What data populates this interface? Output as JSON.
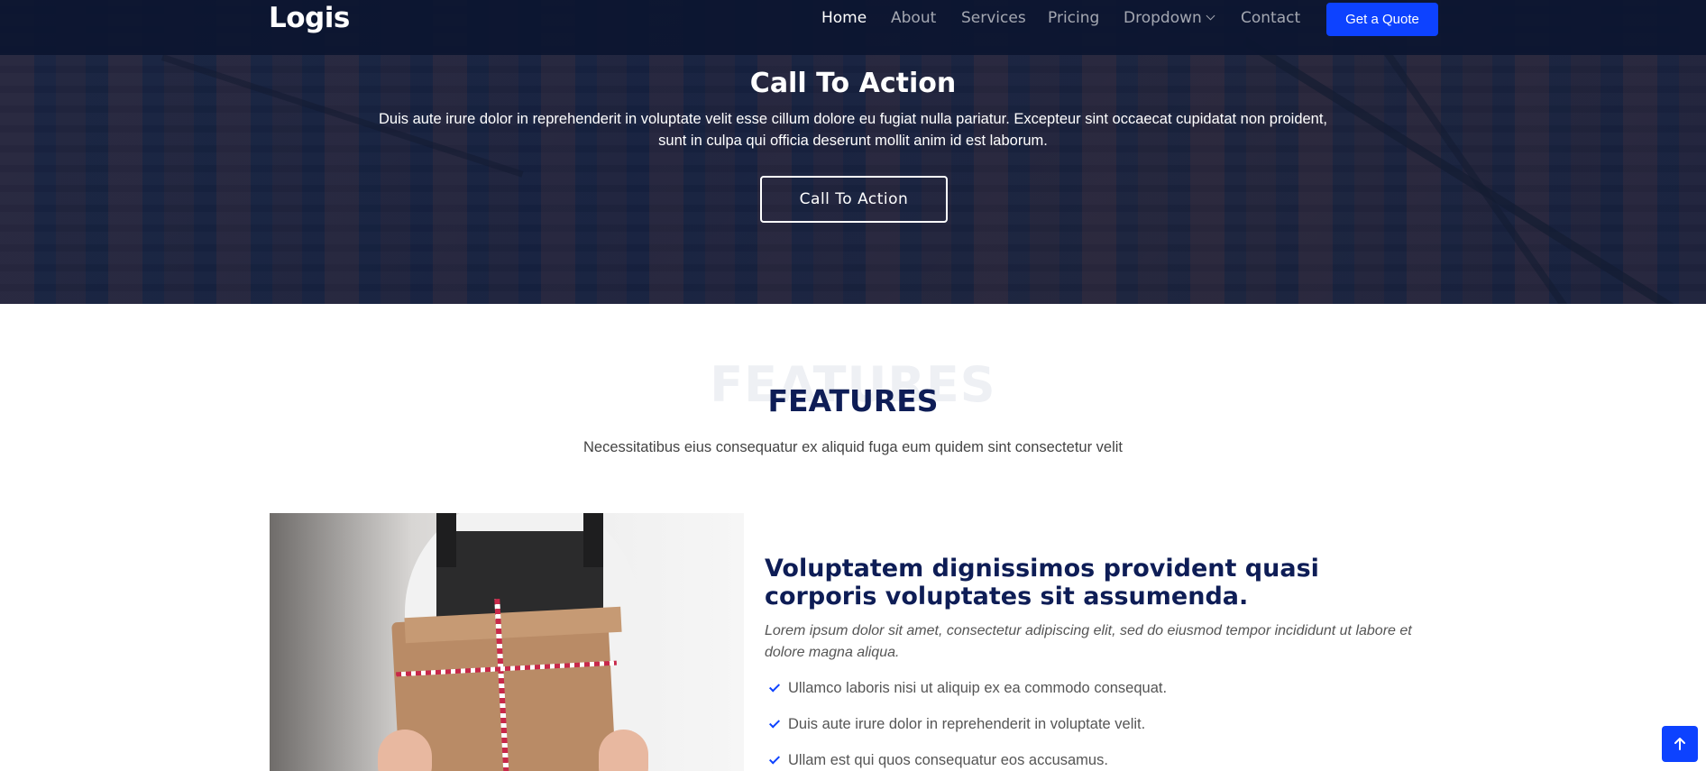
{
  "header": {
    "logo": "Logis",
    "nav": [
      {
        "label": "Home",
        "active": true
      },
      {
        "label": "About"
      },
      {
        "label": "Services"
      },
      {
        "label": "Pricing"
      },
      {
        "label": "Dropdown",
        "has_caret": true
      },
      {
        "label": "Contact"
      }
    ],
    "cta_label": "Get a Quote"
  },
  "hero": {
    "title": "Call To Action",
    "text": "Duis aute irure dolor in reprehenderit in voluptate velit esse cillum dolore eu fugiat nulla pariatur. Excepteur sint occaecat cupidatat non proident, sunt in culpa qui officia deserunt mollit anim id est laborum.",
    "button_label": "Call To Action"
  },
  "features": {
    "ghost_title": "FEATURES",
    "title": "FEATURES",
    "subtitle": "Necessitatibus eius consequatur ex aliquid fuga eum quidem sint consectetur velit",
    "heading": "Voluptatem dignissimos provident quasi corporis voluptates sit assumenda.",
    "lead": "Lorem ipsum dolor sit amet, consectetur adipiscing elit, sed do eiusmod tempor incididunt ut labore et dolore magna aliqua.",
    "items": [
      "Ullamco laboris nisi ut aliquip ex ea commodo consequat.",
      "Duis aute irure dolor in reprehenderit in voluptate velit.",
      "Ullam est qui quos consequatur eos accusamus."
    ]
  },
  "colors": {
    "accent": "#0d42ff",
    "heading": "#0e1d56",
    "header_bg": "#0c1630"
  },
  "icons": {
    "scroll_top": "arrow-up-icon",
    "check": "check-icon",
    "caret": "chevron-down-icon"
  }
}
